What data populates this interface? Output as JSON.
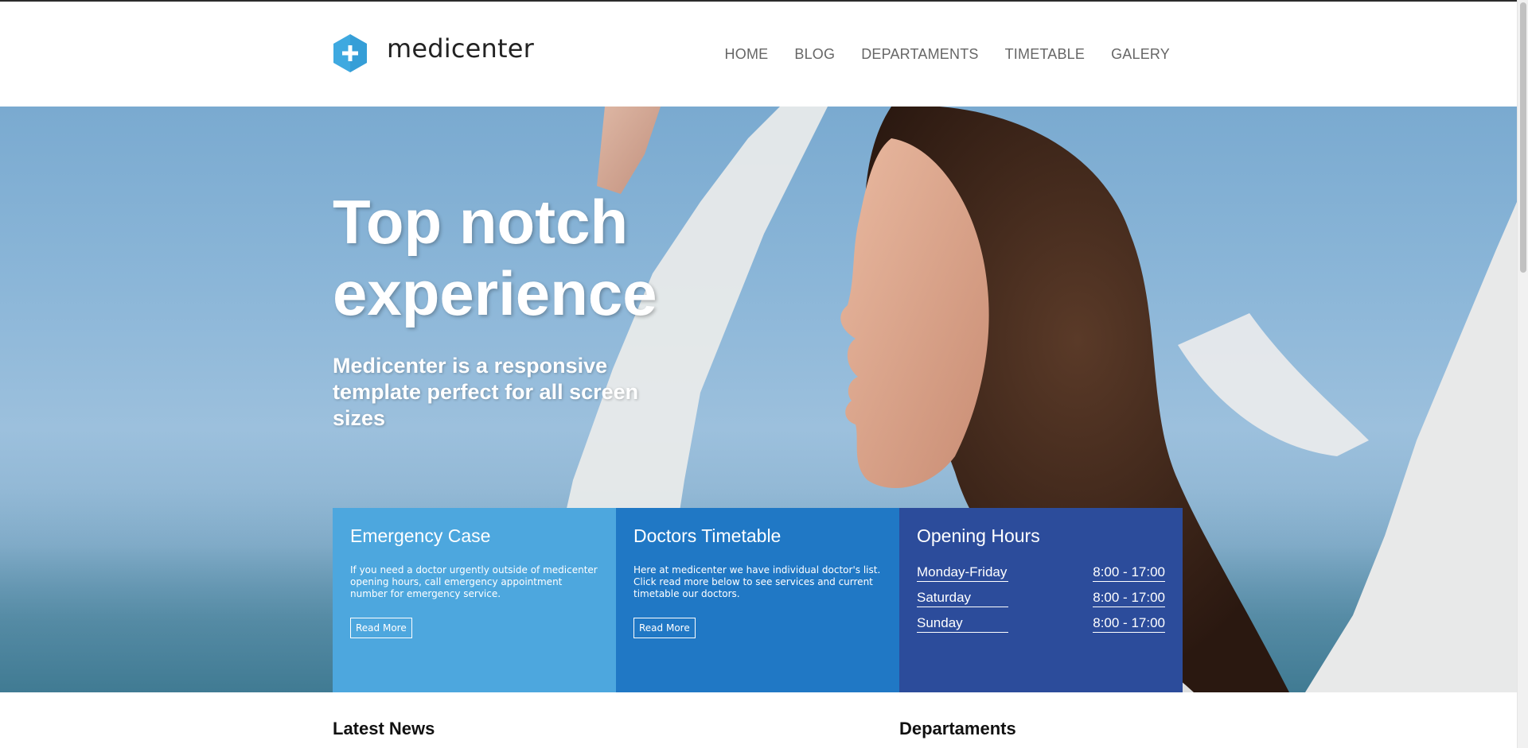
{
  "header": {
    "logo_text": "medicenter",
    "nav": [
      "HOME",
      "BLOG",
      "DEPARTAMENTS",
      "TIMETABLE",
      "GALERY"
    ]
  },
  "hero": {
    "title": "Top notch experience",
    "subtitle": "Medicenter is a responsive template perfect for all screen sizes"
  },
  "boxes": {
    "emergency": {
      "title": "Emergency Case",
      "text": "If you need a doctor urgently outside of medicenter opening hours, call emergency appointment number for emergency service.",
      "button": "Read More"
    },
    "timetable": {
      "title": "Doctors Timetable",
      "text": "Here at medicenter we have individual doctor's list. Click read more below to see services and current timetable our doctors.",
      "button": "Read More"
    },
    "hours": {
      "title": "Opening Hours",
      "rows": [
        {
          "day": "Monday-Friday",
          "time": "8:00 - 17:00"
        },
        {
          "day": "Saturday",
          "time": "8:00 - 17:00"
        },
        {
          "day": "Sunday",
          "time": "8:00 - 17:00"
        }
      ]
    }
  },
  "sections": {
    "latest_news": "Latest News",
    "departaments": "Departaments"
  },
  "colors": {
    "brand": "#3fa9e0",
    "emergency_bg": "#4da7de",
    "timetable_bg": "#2078c5",
    "hours_bg": "#2c4c9b",
    "nav_text": "#666666"
  },
  "icons": {
    "logo": "hexagon-plus-icon"
  }
}
